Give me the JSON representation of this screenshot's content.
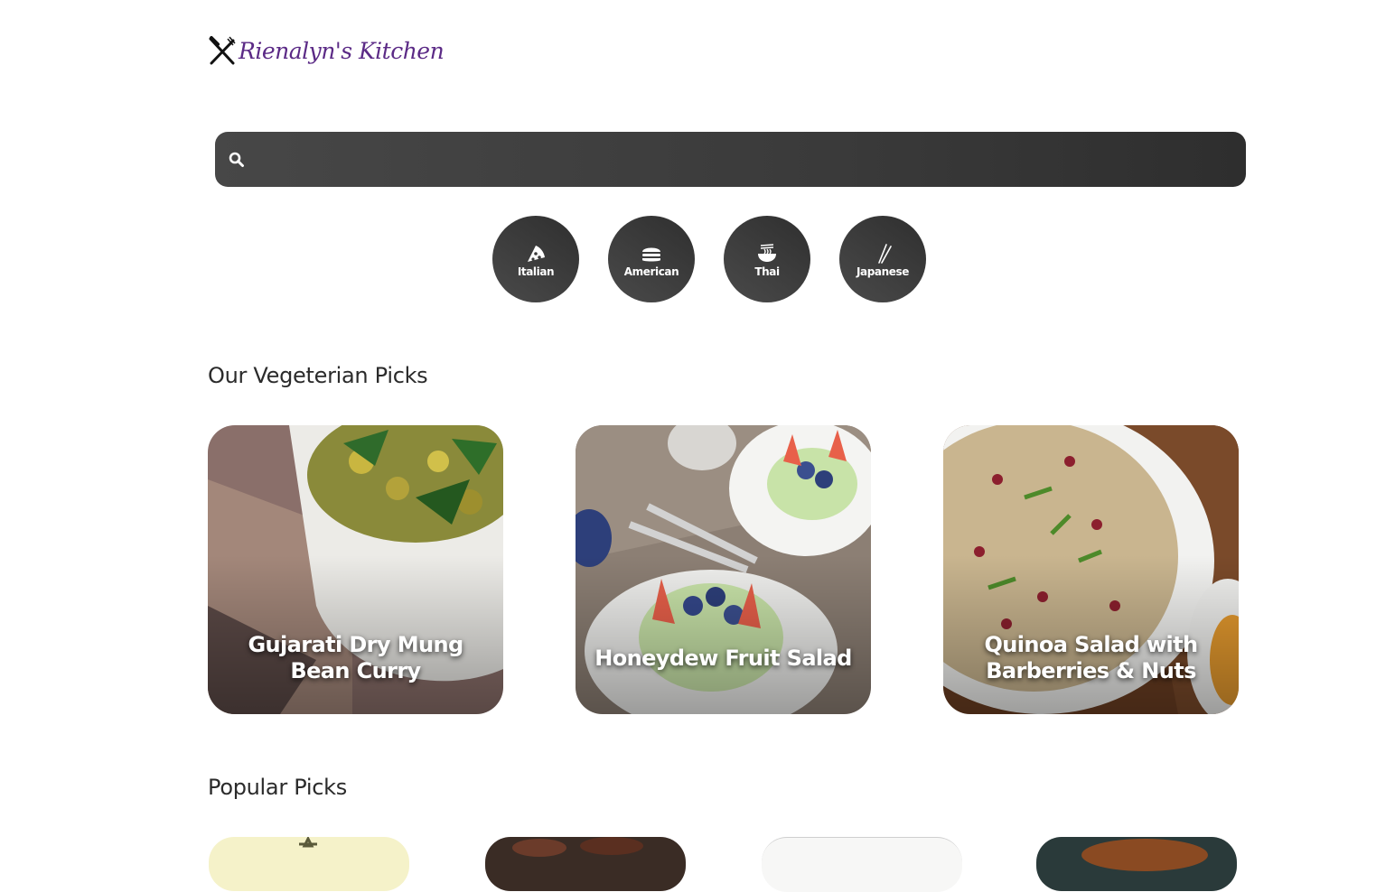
{
  "brand": {
    "name": "Rienalyn's Kitchen",
    "accent": "#5b2a86"
  },
  "search": {
    "placeholder": "",
    "value": "",
    "icon": "search-icon"
  },
  "cuisines": [
    {
      "label": "Italian",
      "icon": "pizza-icon"
    },
    {
      "label": "American",
      "icon": "burger-icon"
    },
    {
      "label": "Thai",
      "icon": "noodle-bowl-icon"
    },
    {
      "label": "Japanese",
      "icon": "chopsticks-icon"
    }
  ],
  "vegetarian": {
    "title": "Our Vegeterian Picks",
    "items": [
      {
        "title": "Gujarati Dry Mung Bean Curry"
      },
      {
        "title": "Honeydew Fruit Salad"
      },
      {
        "title": "Quinoa Salad with Barberries & Nuts"
      }
    ]
  },
  "popular": {
    "title": "Popular Picks",
    "count_visible": 4
  },
  "colors": {
    "dark_button": "#3a3a3a",
    "text": "#2b2b2b",
    "background": "#ffffff"
  }
}
